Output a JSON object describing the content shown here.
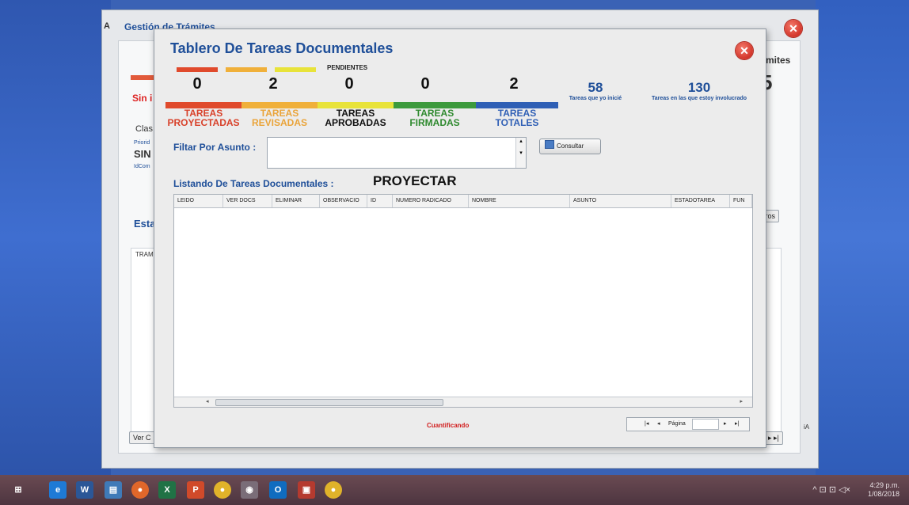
{
  "back_window": {
    "title": "Gestión de Trámites",
    "right_title_fragment": "mites",
    "right_number_fragment": "5",
    "frag_sin": "Sin i",
    "frag_clas": "Clas",
    "frag_prioridad": "Priorid",
    "frag_sin2": "SIN",
    "frag_idcom": "IdCom",
    "frag_esta": "Esta",
    "frag_tram": "TRAM",
    "frag_verc": "Ver C",
    "frag_tros": "tros",
    "frag_a": "A",
    "frag_ha": "iA"
  },
  "modal": {
    "title": "Tablero De Tareas Documentales",
    "pendientes_label": "PENDIENTES",
    "counters": [
      {
        "value": "0",
        "label_line1": "TAREAS",
        "label_line2": "PROYECTADAS",
        "color": "#e04a2c"
      },
      {
        "value": "2",
        "label_line1": "TAREAS",
        "label_line2": "REVISADAS",
        "color": "#f0b03a"
      },
      {
        "value": "0",
        "label_line1": "TAREAS",
        "label_line2": "APROBADAS",
        "color": "#e8e33a"
      },
      {
        "value": "0",
        "label_line1": "TAREAS",
        "label_line2": "FIRMADAS",
        "color": "#3c9a3c"
      },
      {
        "value": "2",
        "label_line1": "TAREAS",
        "label_line2": "TOTALES",
        "color": "#2f5fb5"
      }
    ],
    "stats": [
      {
        "value": "58",
        "caption": "Tareas que yo inicié"
      },
      {
        "value": "130",
        "caption": "Tareas en las que estoy involucrado"
      }
    ],
    "filter_label": "Filtar Por Asunto :",
    "filter_value": "",
    "consultar_label": "Consultar",
    "list_label": "Listando De Tareas Documentales :",
    "mode_label": "PROYECTAR",
    "columns": [
      "LEIDO",
      "VER DOCS",
      "ELIMINAR",
      "OBSERVACIO",
      "ID",
      "NUMERO RADICADO",
      "NOMBRE",
      "ASUNTO",
      "ESTADOTAREA",
      "FUN"
    ],
    "status_text": "Cuantificando",
    "pager": {
      "first": "|◂",
      "prev": "◂",
      "label": "Página",
      "next": "▸",
      "last": "▸|"
    }
  },
  "taskbar": {
    "time": "4:29 p.m.",
    "date": "1/08/2018",
    "tray_glyphs": "^ ⊡ ⊡ ◁×"
  }
}
